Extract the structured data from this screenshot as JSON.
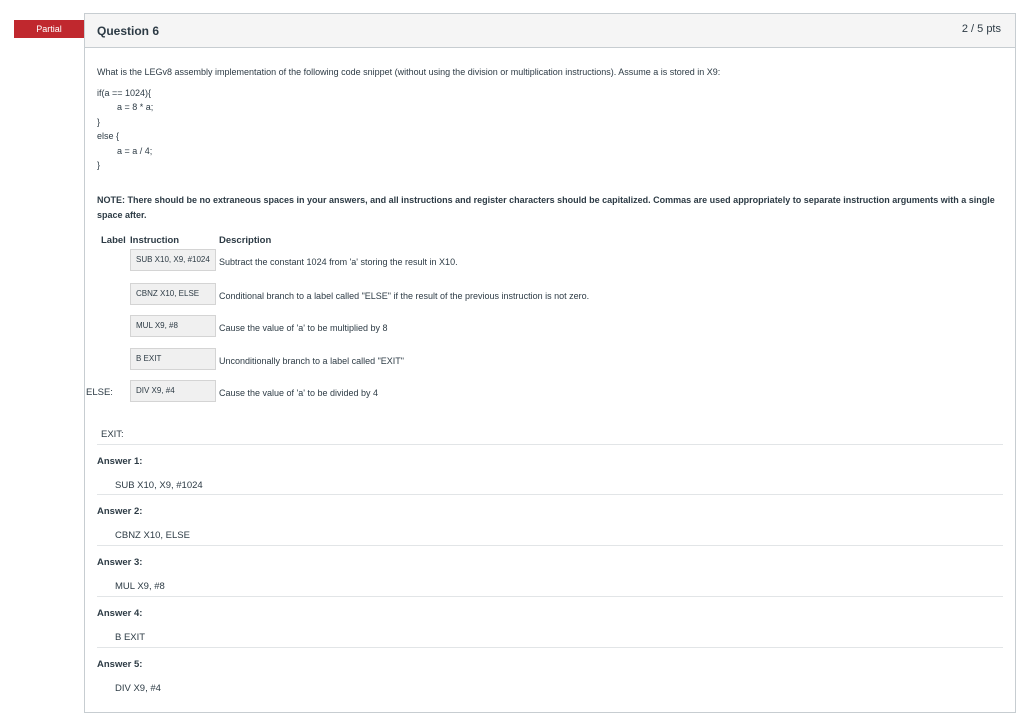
{
  "status": "Partial",
  "question": {
    "title": "Question 6",
    "points": "2 / 5 pts",
    "prompt": "What is the LEGv8 assembly implementation of the following code snippet (without using the division or multiplication instructions).  Assume a is stored in X9:",
    "code": [
      "if(a == 1024){",
      "a = 8 * a;",
      "}",
      "else {",
      "a = a / 4;",
      "}"
    ],
    "note": "NOTE: There should be no extraneous spaces in your answers, and all instructions and register characters should be capitalized.  Commas are used appropriately to separate instruction arguments with a single space after.",
    "table_headers": {
      "label": "Label",
      "instruction": "Instruction",
      "description": "Description"
    },
    "rows": [
      {
        "label": "",
        "value": "SUB X10, X9, #1024",
        "description": "Subtract the constant 1024 from 'a' storing the result in X10."
      },
      {
        "label": "",
        "value": "CBNZ X10, ELSE",
        "description": "Conditional branch to a label called \"ELSE\" if the result of the previous instruction is not zero."
      },
      {
        "label": "",
        "value": "MUL X9, #8",
        "description": "Cause the value of 'a' to be multiplied by 8"
      },
      {
        "label": "",
        "value": "B EXIT",
        "description": "Unconditionally branch to a label called \"EXIT\""
      },
      {
        "label": "ELSE:",
        "value": "DIV X9, #4",
        "description": "Cause the value of 'a' to be divided by 4"
      }
    ],
    "exit_label": "EXIT:",
    "answers": [
      {
        "label": "Answer 1:",
        "value": "SUB X10, X9, #1024"
      },
      {
        "label": "Answer 2:",
        "value": "CBNZ X10, ELSE"
      },
      {
        "label": "Answer 3:",
        "value": "MUL X9, #8"
      },
      {
        "label": "Answer 4:",
        "value": "B EXIT"
      },
      {
        "label": "Answer 5:",
        "value": "DIV X9, #4"
      }
    ]
  }
}
